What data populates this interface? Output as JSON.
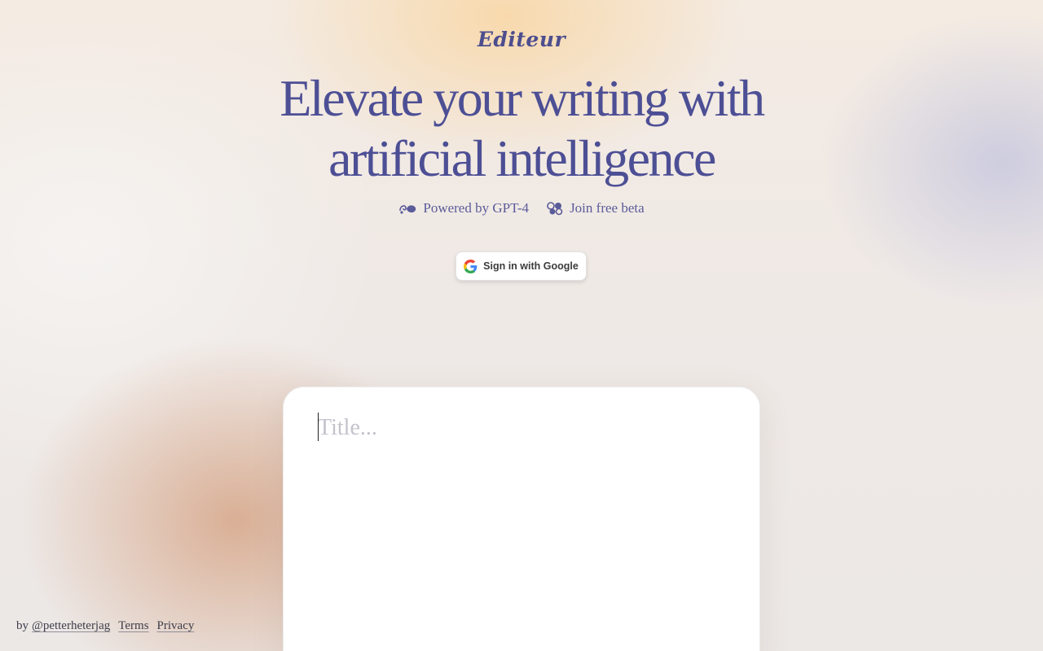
{
  "app": {
    "logo": "Editeur"
  },
  "hero": {
    "line1": "Elevate your writing with",
    "line2": "artificial intelligence"
  },
  "badges": {
    "powered": {
      "label": "Powered by GPT-4",
      "icon": "flourish-icon"
    },
    "beta": {
      "label": "Join free beta",
      "icon": "ornament-icon"
    }
  },
  "auth": {
    "google_label": "Sign in with Google",
    "icon": "google-icon"
  },
  "editor": {
    "title_placeholder": "Title...",
    "title_value": ""
  },
  "footer": {
    "by_prefix": "by",
    "author": "@petterheterjag",
    "terms": "Terms",
    "privacy": "Privacy"
  },
  "colors": {
    "accent": "#4d4f95",
    "text": "#3d3d4a",
    "card": "#ffffff"
  }
}
